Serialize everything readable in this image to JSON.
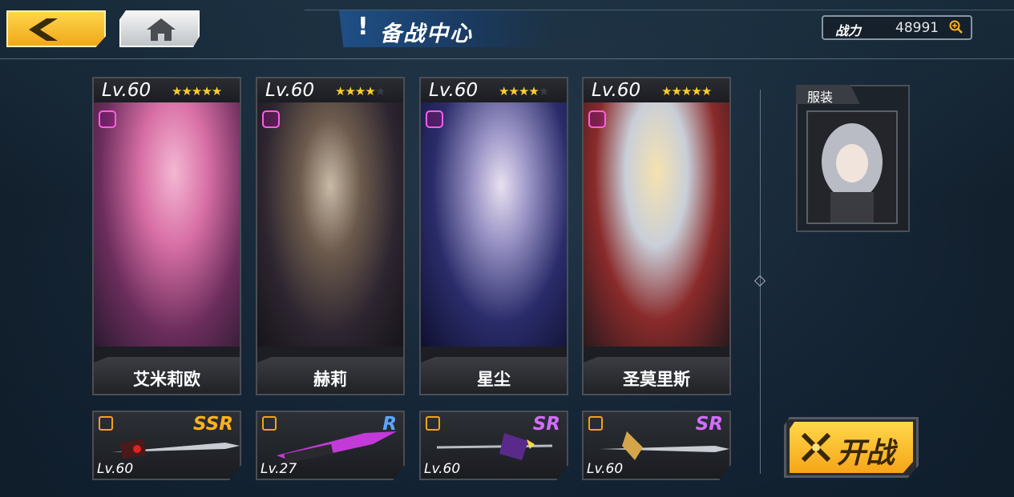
{
  "header": {
    "title_mark": "!",
    "title": "备战中心",
    "power_label": "战力",
    "power_value": "48991"
  },
  "icons": {
    "back": "chevron-left-icon",
    "home": "home-icon",
    "power_zoom": "zoom-in-icon",
    "start": "crossed-swords-icon"
  },
  "heroes": [
    {
      "level": "Lv.60",
      "stars": 5,
      "max_stars": 5,
      "name": "艾米莉欧"
    },
    {
      "level": "Lv.60",
      "stars": 4,
      "max_stars": 5,
      "name": "赫莉"
    },
    {
      "level": "Lv.60",
      "stars": 4,
      "max_stars": 5,
      "name": "星尘"
    },
    {
      "level": "Lv.60",
      "stars": 5,
      "max_stars": 5,
      "name": "圣莫里斯"
    }
  ],
  "weapons": [
    {
      "rarity": "SSR",
      "rarity_color": "#ffb21c",
      "level": "Lv.60"
    },
    {
      "rarity": "R",
      "rarity_color": "#5aa6ff",
      "level": "Lv.27"
    },
    {
      "rarity": "SR",
      "rarity_color": "#d46cff",
      "level": "Lv.60"
    },
    {
      "rarity": "SR",
      "rarity_color": "#d46cff",
      "level": "Lv.60"
    }
  ],
  "costume": {
    "label": "服装"
  },
  "start_button": {
    "label": "开战"
  },
  "colors": {
    "accent_gold": "#f6b21c",
    "title_blue": "#1f4f86",
    "rank_pink": "#ff5ee6"
  }
}
